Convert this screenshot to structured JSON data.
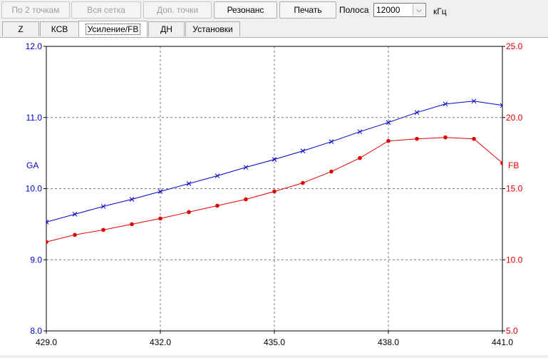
{
  "toolbar": {
    "two_points": "По 2 точкам",
    "whole_grid": "Вся сетка",
    "extra_points": "Доп. точки",
    "resonance": "Резонанс",
    "print": "Печать",
    "band_label": "Полоса",
    "band_value": "12000",
    "band_unit": "кГц"
  },
  "tabs": [
    "Z",
    "КСВ",
    "Усиление/FB",
    "ДН",
    "Установки"
  ],
  "active_tab": "Усиление/FB",
  "colors": {
    "ga": "#0000c8",
    "fb": "#e00000"
  },
  "chart_data": {
    "type": "line",
    "x_ticks": [
      "429.0",
      "432.0",
      "435.0",
      "438.0",
      "441.0"
    ],
    "xlim": [
      429,
      441
    ],
    "left_axis": {
      "label": "GA",
      "ylim": [
        8,
        12
      ],
      "ticks": [
        "12.0",
        "11.0",
        "10.0",
        "9.0",
        "8.0"
      ]
    },
    "right_axis": {
      "label": "FB",
      "ylim": [
        5,
        25
      ],
      "ticks": [
        "25.0",
        "20.0",
        "15.0",
        "10.0",
        "5.0"
      ]
    },
    "grid": true,
    "series": [
      {
        "name": "GA",
        "axis": "left",
        "marker": "x",
        "x": [
          429.0,
          429.75,
          430.5,
          431.25,
          432.0,
          432.75,
          433.5,
          434.25,
          435.0,
          435.75,
          436.5,
          437.25,
          438.0,
          438.75,
          439.5,
          440.25,
          441.0
        ],
        "y": [
          9.53,
          9.64,
          9.75,
          9.85,
          9.96,
          10.07,
          10.18,
          10.3,
          10.41,
          10.53,
          10.66,
          10.8,
          10.93,
          11.07,
          11.19,
          11.23,
          11.17
        ]
      },
      {
        "name": "FB",
        "axis": "right",
        "marker": "dot",
        "x": [
          429.0,
          429.75,
          430.5,
          431.25,
          432.0,
          432.75,
          433.5,
          434.25,
          435.0,
          435.75,
          436.5,
          437.25,
          438.0,
          438.75,
          439.5,
          440.25,
          441.0
        ],
        "y": [
          11.25,
          11.75,
          12.1,
          12.5,
          12.9,
          13.35,
          13.8,
          14.25,
          14.8,
          15.4,
          16.2,
          17.15,
          18.35,
          18.5,
          18.6,
          18.5,
          16.8
        ]
      }
    ]
  }
}
